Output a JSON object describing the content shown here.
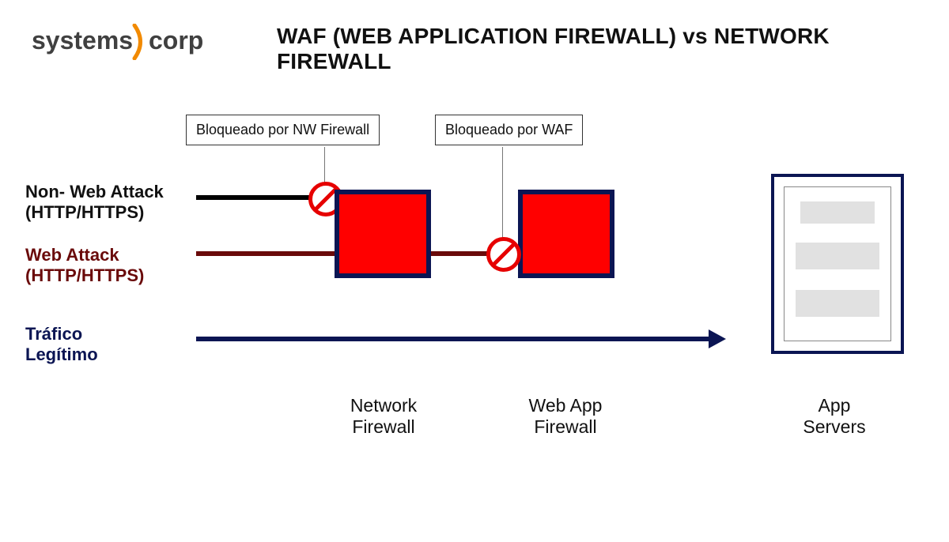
{
  "logo": {
    "left_text": "systems",
    "right_text": "corp"
  },
  "title": "WAF (WEB APPLICATION FIREWALL) vs NETWORK FIREWALL",
  "flows": {
    "non_web": {
      "label": "Non- Web Attack\n(HTTP/HTTPS)",
      "color": "#000000",
      "blocked_by": "nw_firewall"
    },
    "web": {
      "label": "Web Attack\n(HTTP/HTTPS)",
      "color": "#6a0a0a",
      "blocked_by": "waf"
    },
    "legit": {
      "label": "Tráfico\nLegítimo",
      "color": "#0b1553",
      "blocked_by": null
    }
  },
  "callouts": {
    "nw_block": "Bloqueado por NW Firewall",
    "waf_block": "Bloqueado por WAF"
  },
  "nodes": {
    "nw_firewall": "Network\nFirewall",
    "waf": "Web App\nFirewall",
    "servers": "App\nServers"
  },
  "colors": {
    "navy": "#0b1553",
    "red": "#ff0000",
    "border_navy": "#0b1553",
    "darkred": "#6a0a0a",
    "brand_accent": "#f28a00"
  }
}
